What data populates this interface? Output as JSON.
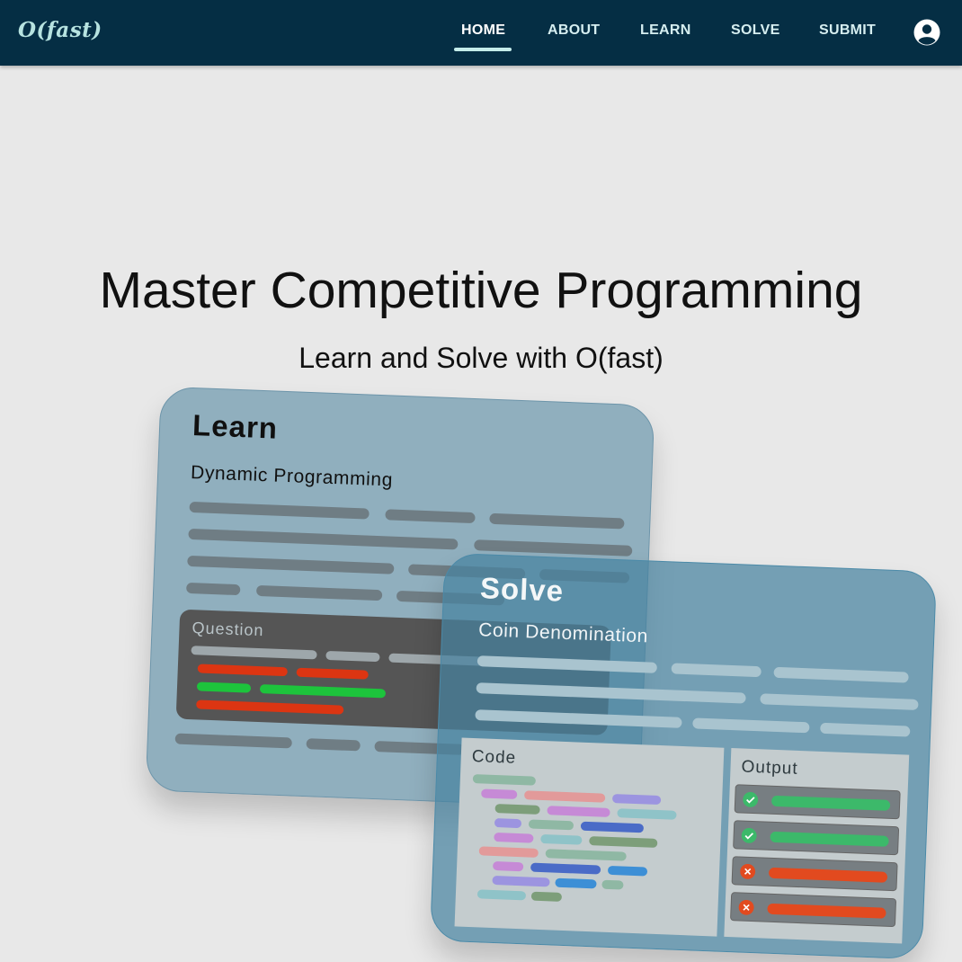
{
  "brand": "O(fast)",
  "nav": {
    "items": [
      "HOME",
      "ABOUT",
      "LEARN",
      "SOLVE",
      "SUBMIT"
    ],
    "active": "HOME",
    "icon_user": "account-circle-icon"
  },
  "hero": {
    "title": "Master Competitive Programming",
    "subtitle": "Learn and Solve with O(fast)"
  },
  "learn_card": {
    "title": "Learn",
    "topic": "Dynamic Programming",
    "question_label": "Question"
  },
  "solve_card": {
    "title": "Solve",
    "problem": "Coin Denomination",
    "code_label": "Code",
    "output_label": "Output",
    "outputs": [
      "pass",
      "pass",
      "fail",
      "fail"
    ]
  },
  "colors": {
    "nav_bg": "#052e44",
    "brand": "#b7e3e0",
    "pass": "#3cb96a",
    "fail": "#e24a1f",
    "question_red": "#dc3512",
    "question_green": "#1dc43c"
  }
}
